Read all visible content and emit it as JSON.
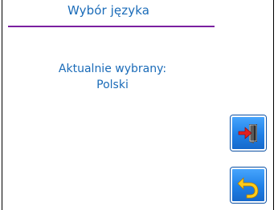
{
  "header": {
    "title": "Wybór języka"
  },
  "main": {
    "current_label": "Aktualnie wybrany:",
    "current_value": "Polski"
  },
  "buttons": {
    "exit_icon": "exit-door-icon",
    "back_icon": "back-arrow-icon"
  },
  "colors": {
    "text": "#1a6bb8",
    "divider": "#7a1fa0",
    "button": "#1e7fe6"
  }
}
